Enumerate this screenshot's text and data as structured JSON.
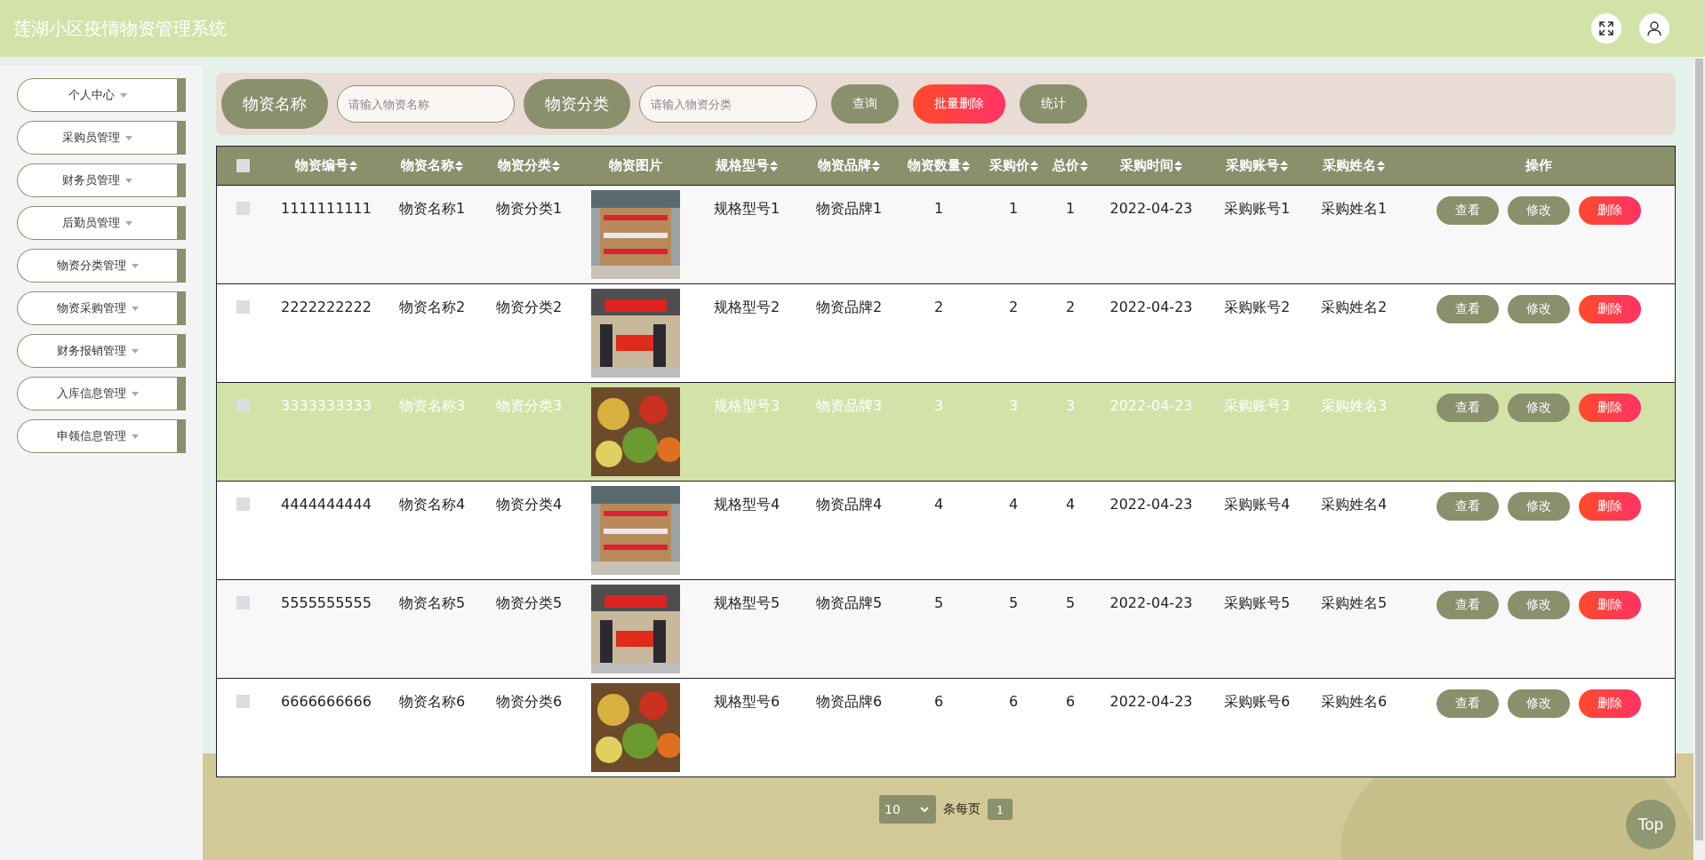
{
  "header": {
    "title": "莲湖小区疫情物资管理系统"
  },
  "sidebar": {
    "items": [
      {
        "label": "个人中心"
      },
      {
        "label": "采购员管理"
      },
      {
        "label": "财务员管理"
      },
      {
        "label": "后勤员管理"
      },
      {
        "label": "物资分类管理"
      },
      {
        "label": "物资采购管理"
      },
      {
        "label": "财务报销管理"
      },
      {
        "label": "入库信息管理"
      },
      {
        "label": "申领信息管理"
      }
    ]
  },
  "search": {
    "fields": [
      {
        "label": "物资名称",
        "placeholder": "请输入物资名称"
      },
      {
        "label": "物资分类",
        "placeholder": "请输入物资分类"
      }
    ],
    "buttons": [
      {
        "label": "查询",
        "kind": "normal"
      },
      {
        "label": "批量删除",
        "kind": "danger"
      },
      {
        "label": "统计",
        "kind": "normal"
      }
    ]
  },
  "table": {
    "select_all": {
      "checked": false
    },
    "columns": [
      {
        "label": "物资编号",
        "sortable": true,
        "kind": "text"
      },
      {
        "label": "物资名称",
        "sortable": true,
        "kind": "text"
      },
      {
        "label": "物资分类",
        "sortable": true,
        "kind": "text"
      },
      {
        "label": "物资图片",
        "sortable": false
      },
      {
        "label": "规格型号",
        "sortable": true,
        "kind": "text"
      },
      {
        "label": "物资品牌",
        "sortable": true,
        "kind": "text"
      },
      {
        "label": "物资数量",
        "sortable": true,
        "kind": "text"
      },
      {
        "label": "采购价",
        "sortable": true,
        "kind": "text"
      },
      {
        "label": "总价",
        "sortable": true,
        "kind": "text"
      },
      {
        "label": "采购时间",
        "sortable": true,
        "kind": "text"
      },
      {
        "label": "采购账号",
        "sortable": true,
        "kind": "text"
      },
      {
        "label": "采购姓名",
        "sortable": true,
        "kind": "text"
      },
      {
        "label": "操作",
        "sortable": false,
        "kind": "actions"
      }
    ],
    "rows": [
      {
        "checked": false,
        "highlighted": false,
        "cells": [
          "1111111111",
          "物资名称1",
          "物资分类1",
          "",
          "规格型号1",
          "物资品牌1",
          "1",
          "1",
          "1",
          "2022-04-23",
          "采购账号1",
          "采购姓名1"
        ],
        "actions": [
          "查看",
          "修改",
          "删除"
        ]
      },
      {
        "checked": false,
        "highlighted": false,
        "cells": [
          "2222222222",
          "物资名称2",
          "物资分类2",
          "",
          "规格型号2",
          "物资品牌2",
          "2",
          "2",
          "2",
          "2022-04-23",
          "采购账号2",
          "采购姓名2"
        ],
        "actions": [
          "查看",
          "修改",
          "删除"
        ]
      },
      {
        "checked": false,
        "highlighted": true,
        "cells": [
          "3333333333",
          "物资名称3",
          "物资分类3",
          "",
          "规格型号3",
          "物资品牌3",
          "3",
          "3",
          "3",
          "2022-04-23",
          "采购账号3",
          "采购姓名3"
        ],
        "actions": [
          "查看",
          "修改",
          "删除"
        ]
      },
      {
        "checked": false,
        "highlighted": false,
        "cells": [
          "4444444444",
          "物资名称4",
          "物资分类4",
          "",
          "规格型号4",
          "物资品牌4",
          "4",
          "4",
          "4",
          "2022-04-23",
          "采购账号4",
          "采购姓名4"
        ],
        "actions": [
          "查看",
          "修改",
          "删除"
        ]
      },
      {
        "checked": false,
        "highlighted": false,
        "cells": [
          "5555555555",
          "物资名称5",
          "物资分类5",
          "",
          "规格型号5",
          "物资品牌5",
          "5",
          "5",
          "5",
          "2022-04-23",
          "采购账号5",
          "采购姓名5"
        ],
        "actions": [
          "查看",
          "修改",
          "删除"
        ]
      },
      {
        "checked": false,
        "highlighted": false,
        "cells": [
          "6666666666",
          "物资名称6",
          "物资分类6",
          "",
          "规格型号6",
          "物资品牌6",
          "6",
          "6",
          "6",
          "2022-04-23",
          "采购账号6",
          "采购姓名6"
        ],
        "actions": [
          "查看",
          "修改",
          "删除"
        ]
      }
    ]
  },
  "pagination": {
    "page_size": "10",
    "per_page_label": "条每页",
    "pages": [
      {
        "label": "1",
        "selected": true
      }
    ]
  },
  "top_button": {
    "label": "Top"
  }
}
